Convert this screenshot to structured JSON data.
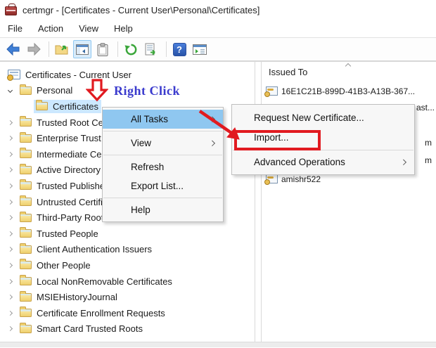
{
  "window": {
    "title": "certmgr - [Certificates - Current User\\Personal\\Certificates]"
  },
  "menubar": {
    "items": [
      "File",
      "Action",
      "View",
      "Help"
    ]
  },
  "toolbar": {
    "icons": [
      "back",
      "forward",
      "export-folder",
      "show-hide-console-tree",
      "clipboard",
      "refresh",
      "export-list",
      "help",
      "new-console-window"
    ]
  },
  "tree": {
    "items": [
      {
        "label": "Certificates - Current User",
        "level": 0,
        "icon": "certmgr",
        "chevron": null,
        "selected": false
      },
      {
        "label": "Personal",
        "level": 1,
        "icon": "folder",
        "chevron": "expanded",
        "selected": false
      },
      {
        "label": "Certificates",
        "level": 2,
        "icon": "folder",
        "chevron": null,
        "selected": true
      },
      {
        "label": "Trusted Root Certification Authorities",
        "level": 1,
        "icon": "folder",
        "chevron": "collapsed",
        "selected": false
      },
      {
        "label": "Enterprise Trust",
        "level": 1,
        "icon": "folder",
        "chevron": "collapsed",
        "selected": false
      },
      {
        "label": "Intermediate Certification Authorities",
        "level": 1,
        "icon": "folder",
        "chevron": "collapsed",
        "selected": false
      },
      {
        "label": "Active Directory User Object",
        "level": 1,
        "icon": "folder",
        "chevron": "collapsed",
        "selected": false
      },
      {
        "label": "Trusted Publishers",
        "level": 1,
        "icon": "folder",
        "chevron": "collapsed",
        "selected": false
      },
      {
        "label": "Untrusted Certificates",
        "level": 1,
        "icon": "folder",
        "chevron": "collapsed",
        "selected": false
      },
      {
        "label": "Third-Party Root Certification Authorities",
        "level": 1,
        "icon": "folder",
        "chevron": "collapsed",
        "selected": false
      },
      {
        "label": "Trusted People",
        "level": 1,
        "icon": "folder",
        "chevron": "collapsed",
        "selected": false
      },
      {
        "label": "Client Authentication Issuers",
        "level": 1,
        "icon": "folder",
        "chevron": "collapsed",
        "selected": false
      },
      {
        "label": "Other People",
        "level": 1,
        "icon": "folder",
        "chevron": "collapsed",
        "selected": false
      },
      {
        "label": "Local NonRemovable Certificates",
        "level": 1,
        "icon": "folder",
        "chevron": "collapsed",
        "selected": false
      },
      {
        "label": "MSIEHistoryJournal",
        "level": 1,
        "icon": "folder",
        "chevron": "collapsed",
        "selected": false
      },
      {
        "label": "Certificate Enrollment Requests",
        "level": 1,
        "icon": "folder",
        "chevron": "collapsed",
        "selected": false
      },
      {
        "label": "Smart Card Trusted Roots",
        "level": 1,
        "icon": "folder",
        "chevron": "collapsed",
        "selected": false
      }
    ]
  },
  "list": {
    "header": "Issued To",
    "rows": [
      {
        "icon": true,
        "text": "16E1C21B-899D-41B3-A13B-367..."
      },
      {
        "icon": true,
        "fragment": "ast..."
      },
      {},
      {
        "fragment": "m"
      },
      {
        "fragment": "m"
      },
      {
        "icon": true,
        "text": "amishr522"
      }
    ]
  },
  "context_menu": {
    "items": [
      "All Tasks",
      "View",
      "Refresh",
      "Export List...",
      "Help"
    ]
  },
  "submenu": {
    "items": [
      "Request New Certificate...",
      "Import...",
      "Advanced Operations"
    ]
  },
  "annotations": {
    "right_click_label": "Right Click",
    "colors": {
      "red": "#e11a20",
      "blue": "#3a3acd"
    }
  },
  "colors": {
    "menu_highlight": "#8fc7f0",
    "tree_selection": "#cce8ff"
  }
}
